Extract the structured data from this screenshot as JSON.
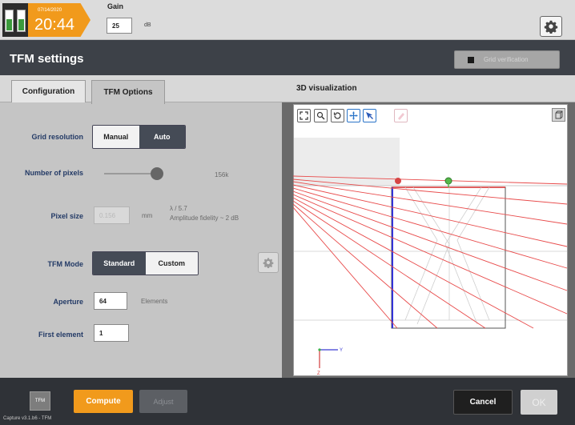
{
  "status": {
    "date": "07/14/2020",
    "time": "20:44",
    "battery_count": 2
  },
  "gain": {
    "label": "Gain",
    "value": "25",
    "unit": "dB"
  },
  "window": {
    "title": "TFM settings",
    "grid_verification_label": "Grid verification"
  },
  "tabs": [
    {
      "label": "Configuration",
      "active": false
    },
    {
      "label": "TFM Options",
      "active": true
    }
  ],
  "form": {
    "grid_resolution": {
      "label": "Grid resolution",
      "options": [
        "Manual",
        "Auto"
      ],
      "selected": "Auto"
    },
    "number_of_pixels": {
      "label": "Number of pixels",
      "value": "156k",
      "slider_fraction": 0.92
    },
    "pixel_size": {
      "label": "Pixel size",
      "value": "0.156",
      "unit": "mm",
      "lambda_note": "λ / 5.7",
      "fidelity_note": "Amplitude fidelity ~ 2 dB"
    },
    "tfm_mode": {
      "label": "TFM Mode",
      "options": [
        "Standard",
        "Custom"
      ],
      "selected": "Standard"
    },
    "aperture": {
      "label": "Aperture",
      "value": "64",
      "unit": "Elements"
    },
    "first_element": {
      "label": "First element",
      "value": "1"
    }
  },
  "visualization": {
    "title": "3D visualization",
    "toolbar": [
      "fit-icon",
      "zoom-icon",
      "rotate-icon",
      "pan-icon",
      "select-icon",
      "erase-icon"
    ],
    "axis_labels": {
      "y": "Y",
      "z": "Z"
    },
    "colors": {
      "rays": "#e84a4a",
      "wedge": "#3434d8",
      "marker_red": "#d64545",
      "marker_green": "#56b84a"
    }
  },
  "footer": {
    "mode_button": "TFM",
    "compute_label": "Compute",
    "adjust_label": "Adjust",
    "cancel_label": "Cancel",
    "ok_label": "OK",
    "version": "Capture v3.1.b6 - TFM"
  },
  "colors": {
    "accent": "#f19a1c",
    "title_bar": "#3d4148",
    "label_blue": "#233a66"
  }
}
